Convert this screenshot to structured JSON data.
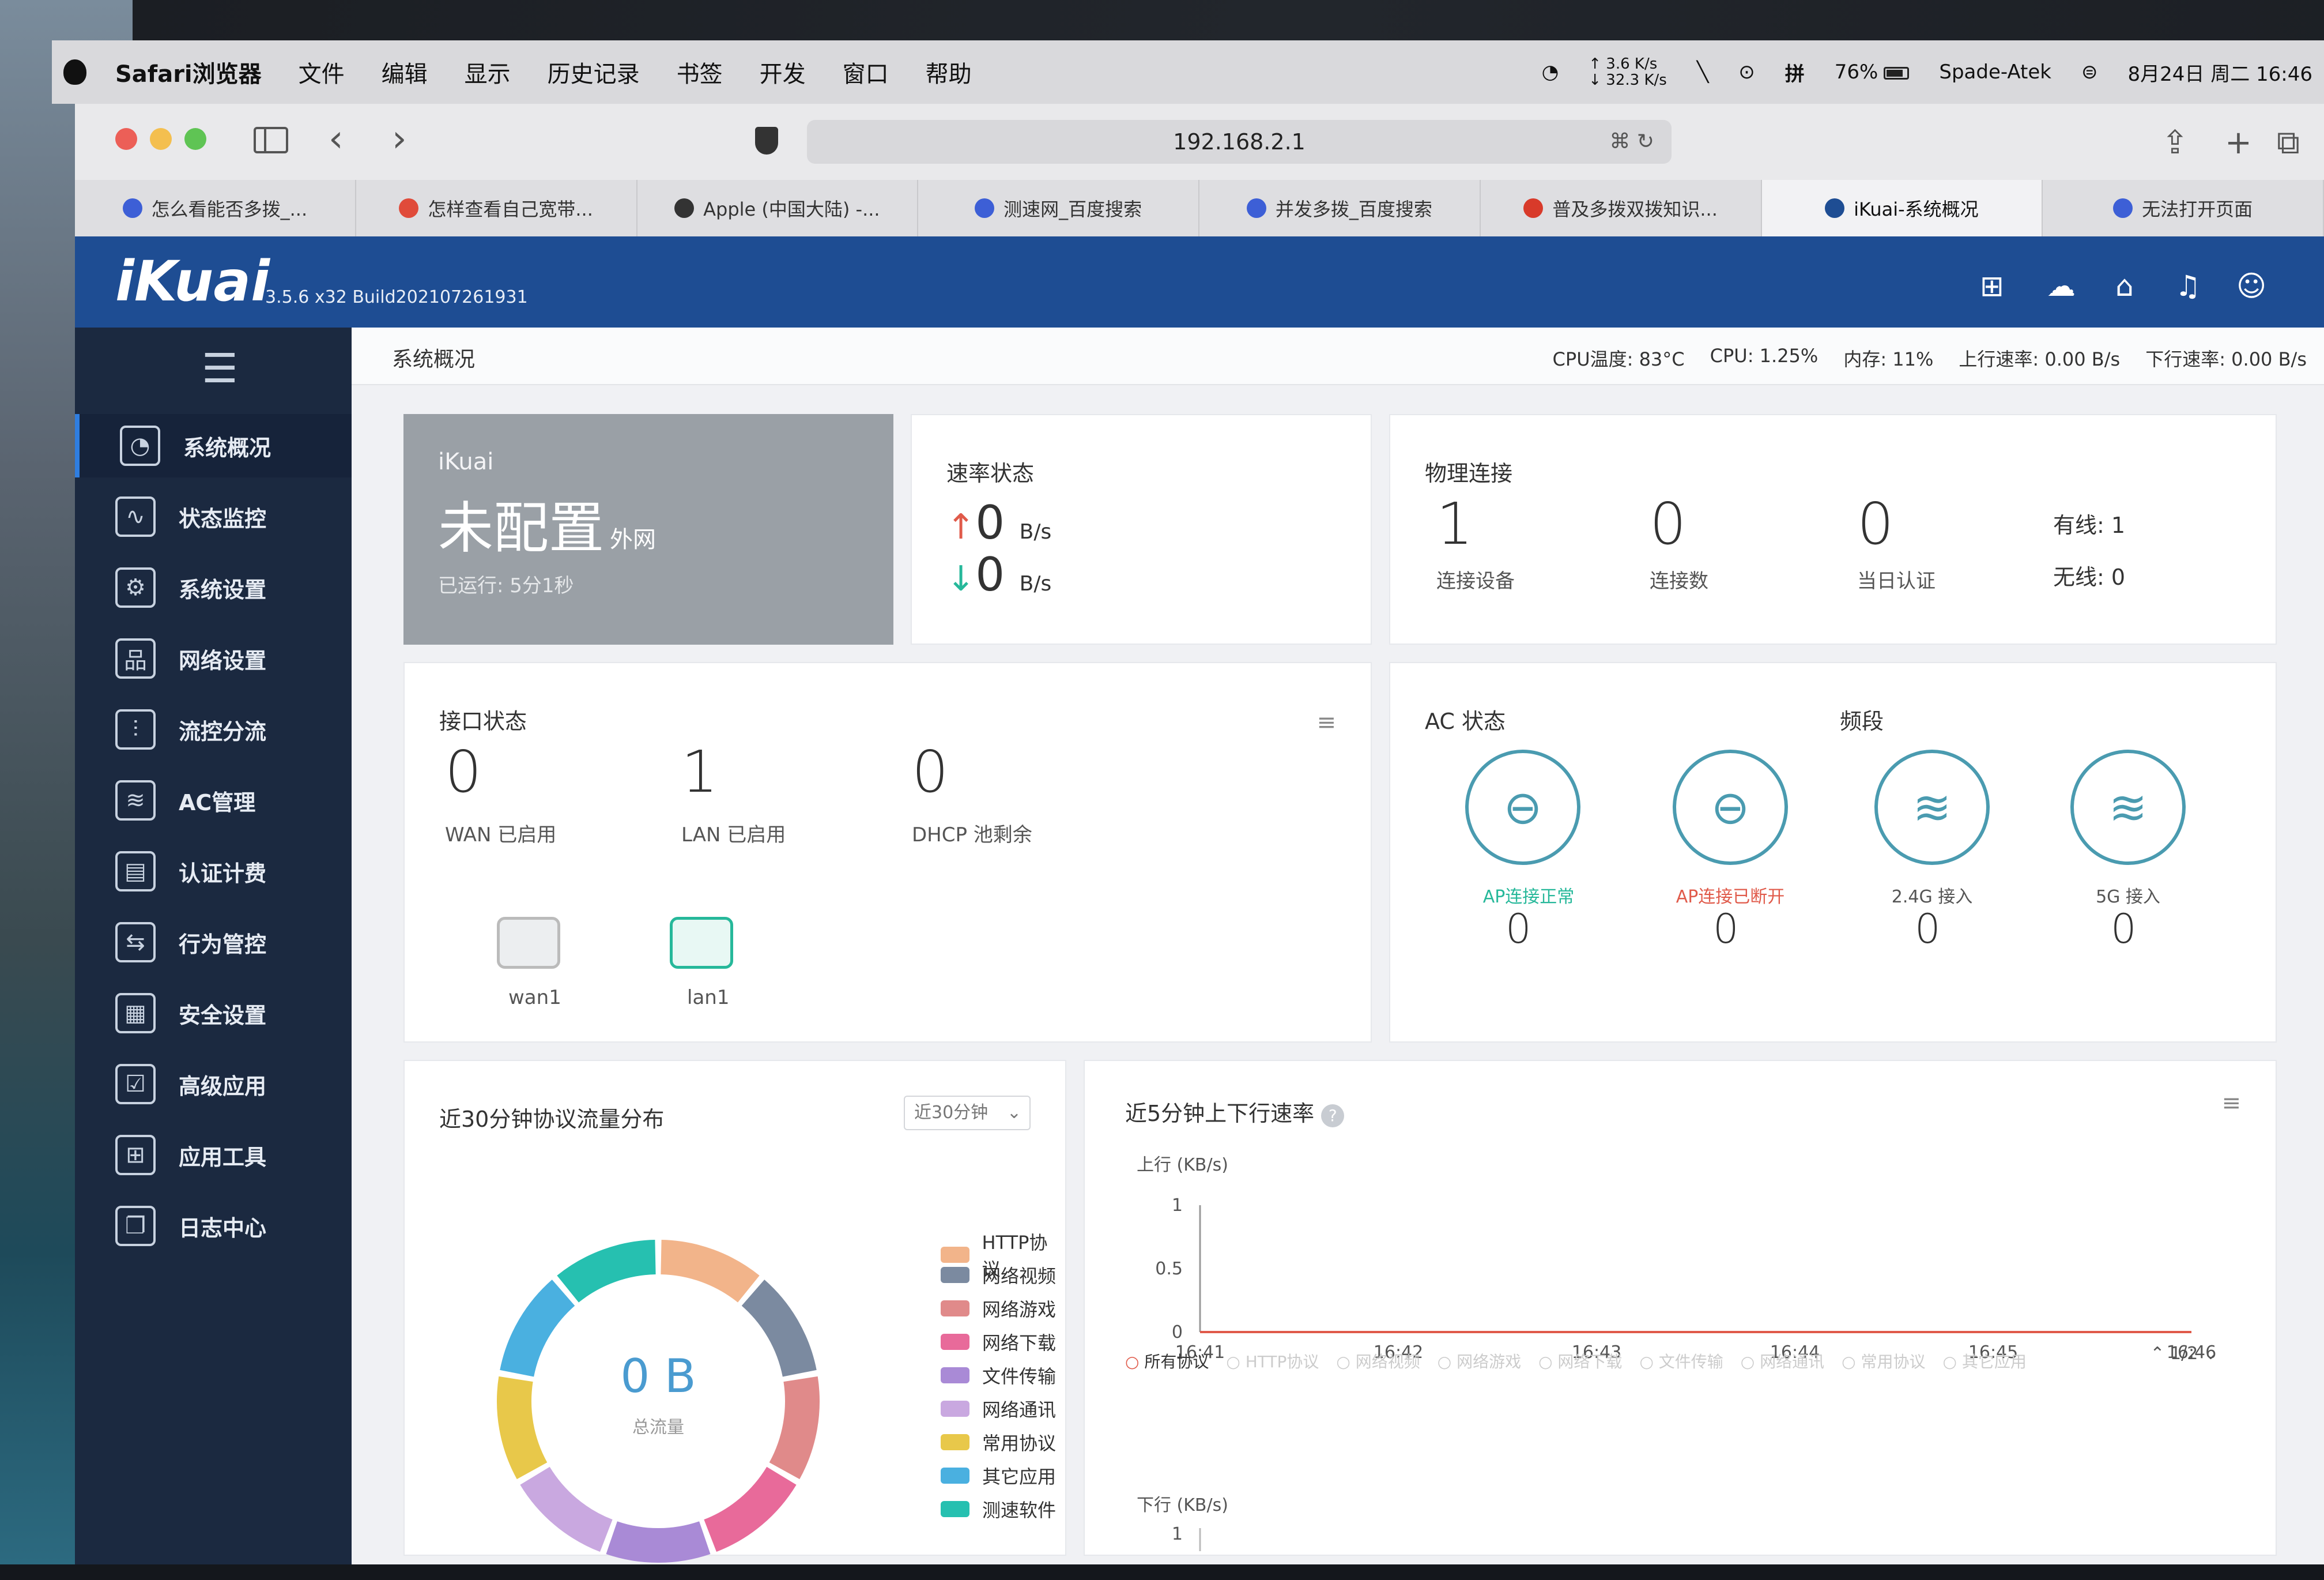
{
  "menubar": {
    "app": "Safari浏览器",
    "items": [
      "文件",
      "编辑",
      "显示",
      "历史记录",
      "书签",
      "开发",
      "窗口",
      "帮助"
    ],
    "net_up": "↑ 3.6 K/s",
    "net_down": "↓ 32.3 K/s",
    "battery": "76%",
    "user": "Spade-Atek",
    "datetime": "8月24日 周二 16:46"
  },
  "browser": {
    "url": "192.168.2.1",
    "tabs": [
      {
        "label": "怎么看能否多拨_...",
        "color": "#3d5fd6"
      },
      {
        "label": "怎样查看自己宽带...",
        "color": "#e04b3a"
      },
      {
        "label": "Apple (中国大陆) -...",
        "color": "#333333"
      },
      {
        "label": "测速网_百度搜索",
        "color": "#3d5fd6"
      },
      {
        "label": "并发多拨_百度搜索",
        "color": "#3d5fd6"
      },
      {
        "label": "普及多拨双拨知识...",
        "color": "#d83a2a"
      },
      {
        "label": "iKuai-系统概况",
        "color": "#1e4d93"
      },
      {
        "label": "无法打开页面",
        "color": "#3d5fd6"
      }
    ],
    "active_tab": 6
  },
  "header": {
    "logo": "iKuai",
    "version": "3.5.6 x32 Build202107261931"
  },
  "nav": {
    "items": [
      {
        "label": "系统概况",
        "icon": "gauge-icon",
        "glyph": "◔"
      },
      {
        "label": "状态监控",
        "icon": "pulse-icon",
        "glyph": "∿"
      },
      {
        "label": "系统设置",
        "icon": "gear-icon",
        "glyph": "⚙"
      },
      {
        "label": "网络设置",
        "icon": "network-icon",
        "glyph": "品"
      },
      {
        "label": "流控分流",
        "icon": "sliders-icon",
        "glyph": "⫶"
      },
      {
        "label": "AC管理",
        "icon": "wifi-icon",
        "glyph": "≋"
      },
      {
        "label": "认证计费",
        "icon": "idcard-icon",
        "glyph": "▤"
      },
      {
        "label": "行为管控",
        "icon": "swap-icon",
        "glyph": "⇆"
      },
      {
        "label": "安全设置",
        "icon": "firewall-icon",
        "glyph": "▦"
      },
      {
        "label": "高级应用",
        "icon": "checkbox-icon",
        "glyph": "☑"
      },
      {
        "label": "应用工具",
        "icon": "apps-icon",
        "glyph": "⊞"
      },
      {
        "label": "日志中心",
        "icon": "document-icon",
        "glyph": "❐"
      }
    ]
  },
  "crumb": "系统概况",
  "stats": {
    "cpu_temp": "CPU温度: 83°C",
    "cpu": "CPU: 1.25%",
    "mem": "内存: 11%",
    "up": "上行速率: 0.00 B/s",
    "down": "下行速率: 0.00 B/s"
  },
  "ikuai_card": {
    "brand": "iKuai",
    "status": "未配置",
    "status_sub": "外网",
    "uptime": "已运行: 5分1秒"
  },
  "speed": {
    "title": "速率状态",
    "up_value": "0",
    "up_unit": "B/s",
    "down_value": "0",
    "down_unit": "B/s"
  },
  "physical": {
    "title": "物理连接",
    "devices": "1",
    "devices_label": "连接设备",
    "conns": "0",
    "conns_label": "连接数",
    "auth": "0",
    "auth_label": "当日认证",
    "wired": "有线: 1",
    "wireless": "无线: 0"
  },
  "iface": {
    "title": "接口状态",
    "wan": "0",
    "wan_label": "WAN 已启用",
    "lan": "1",
    "lan_label": "LAN 已启用",
    "dhcp": "0",
    "dhcp_label": "DHCP 池剩余",
    "port1": "wan1",
    "port2": "lan1"
  },
  "ac": {
    "title": "AC 状态",
    "band_title": "频段",
    "items": [
      {
        "label": "AP连接正常",
        "value": "0",
        "color": "#26b89a"
      },
      {
        "label": "AP连接已断开",
        "value": "0",
        "color": "#e05a4a"
      },
      {
        "label": "2.4G 接入",
        "value": "0",
        "color": "#555555"
      },
      {
        "label": "5G 接入",
        "value": "0",
        "color": "#555555"
      }
    ]
  },
  "proto": {
    "title": "近30分钟协议流量分布",
    "select": "近30分钟",
    "total": "0 B",
    "total_label": "总流量",
    "legend": [
      {
        "label": "HTTP协议",
        "color": "#f2b48a"
      },
      {
        "label": "网络视频",
        "color": "#7b8aa0"
      },
      {
        "label": "网络游戏",
        "color": "#e08a8a"
      },
      {
        "label": "网络下载",
        "color": "#e86a9a"
      },
      {
        "label": "文件传输",
        "color": "#a98ad6"
      },
      {
        "label": "网络通讯",
        "color": "#c9a8e0"
      },
      {
        "label": "常用协议",
        "color": "#e8c84a"
      },
      {
        "label": "其它应用",
        "color": "#4ab0e0"
      },
      {
        "label": "测速软件",
        "color": "#26c0b0"
      }
    ]
  },
  "rate": {
    "title": "近5分钟上下行速率",
    "up_axis": "上行 (KB/s)",
    "y_ticks": [
      "1",
      "0.5",
      "0"
    ],
    "x_ticks": [
      "16:41",
      "16:42",
      "16:43",
      "16:44",
      "16:45",
      "16:46"
    ],
    "legend_first": "所有协议",
    "legend_rest": [
      "HTTP协议",
      "网络视频",
      "网络游戏",
      "网络下载",
      "文件传输",
      "网络通讯",
      "常用协议",
      "其它应用"
    ],
    "pager": "1/2",
    "down_axis": "下行 (KB/s)",
    "down_tick": "1"
  },
  "chart_data": {
    "type": "line",
    "ylabel": "上行 (KB/s)",
    "x": [
      "16:41",
      "16:42",
      "16:43",
      "16:44",
      "16:45",
      "16:46"
    ],
    "series": [
      {
        "values": [
          0,
          0,
          0,
          0,
          0,
          0
        ]
      }
    ],
    "ylim": [
      0,
      1
    ]
  }
}
